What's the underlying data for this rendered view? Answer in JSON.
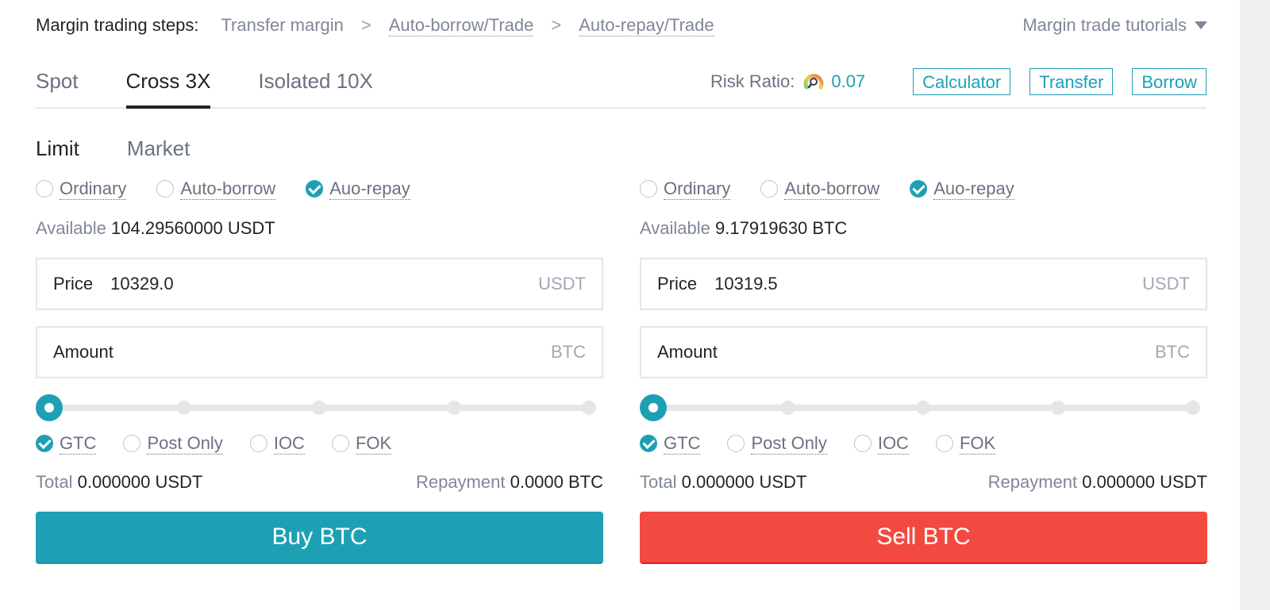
{
  "steps": {
    "title": "Margin trading steps:",
    "items": [
      "Transfer margin",
      "Auto-borrow/Trade",
      "Auto-repay/Trade"
    ],
    "separator": ">",
    "tutorials_label": "Margin trade tutorials"
  },
  "tabs": [
    {
      "label": "Spot",
      "active": false
    },
    {
      "label": "Cross 3X",
      "active": true
    },
    {
      "label": "Isolated 10X",
      "active": false
    }
  ],
  "risk": {
    "label": "Risk Ratio:",
    "value": "0.07"
  },
  "actions": {
    "calculator": "Calculator",
    "transfer": "Transfer",
    "borrow": "Borrow"
  },
  "order_types": [
    {
      "label": "Limit",
      "active": true
    },
    {
      "label": "Market",
      "active": false
    }
  ],
  "colors": {
    "accent": "#1ea0b4",
    "sell": "#f24a40"
  },
  "buy": {
    "modes": [
      {
        "label": "Ordinary",
        "checked": false
      },
      {
        "label": "Auto-borrow",
        "checked": false
      },
      {
        "label": "Auo-repay",
        "checked": true
      }
    ],
    "available_label": "Available",
    "available_value": "104.29560000 USDT",
    "price_label": "Price",
    "price_value": "10329.0",
    "price_unit": "USDT",
    "amount_label": "Amount",
    "amount_value": "",
    "amount_unit": "BTC",
    "slider_percent": 0,
    "tif": [
      {
        "label": "GTC",
        "checked": true
      },
      {
        "label": "Post Only",
        "checked": false
      },
      {
        "label": "IOC",
        "checked": false
      },
      {
        "label": "FOK",
        "checked": false
      }
    ],
    "total_label": "Total",
    "total_value": "0.000000 USDT",
    "repayment_label": "Repayment",
    "repayment_value": "0.0000 BTC",
    "button_label": "Buy BTC"
  },
  "sell": {
    "modes": [
      {
        "label": "Ordinary",
        "checked": false
      },
      {
        "label": "Auto-borrow",
        "checked": false
      },
      {
        "label": "Auo-repay",
        "checked": true
      }
    ],
    "available_label": "Available",
    "available_value": "9.17919630 BTC",
    "price_label": "Price",
    "price_value": "10319.5",
    "price_unit": "USDT",
    "amount_label": "Amount",
    "amount_value": "",
    "amount_unit": "BTC",
    "slider_percent": 0,
    "tif": [
      {
        "label": "GTC",
        "checked": true
      },
      {
        "label": "Post Only",
        "checked": false
      },
      {
        "label": "IOC",
        "checked": false
      },
      {
        "label": "FOK",
        "checked": false
      }
    ],
    "total_label": "Total",
    "total_value": "0.000000 USDT",
    "repayment_label": "Repayment",
    "repayment_value": "0.000000 USDT",
    "button_label": "Sell BTC"
  }
}
